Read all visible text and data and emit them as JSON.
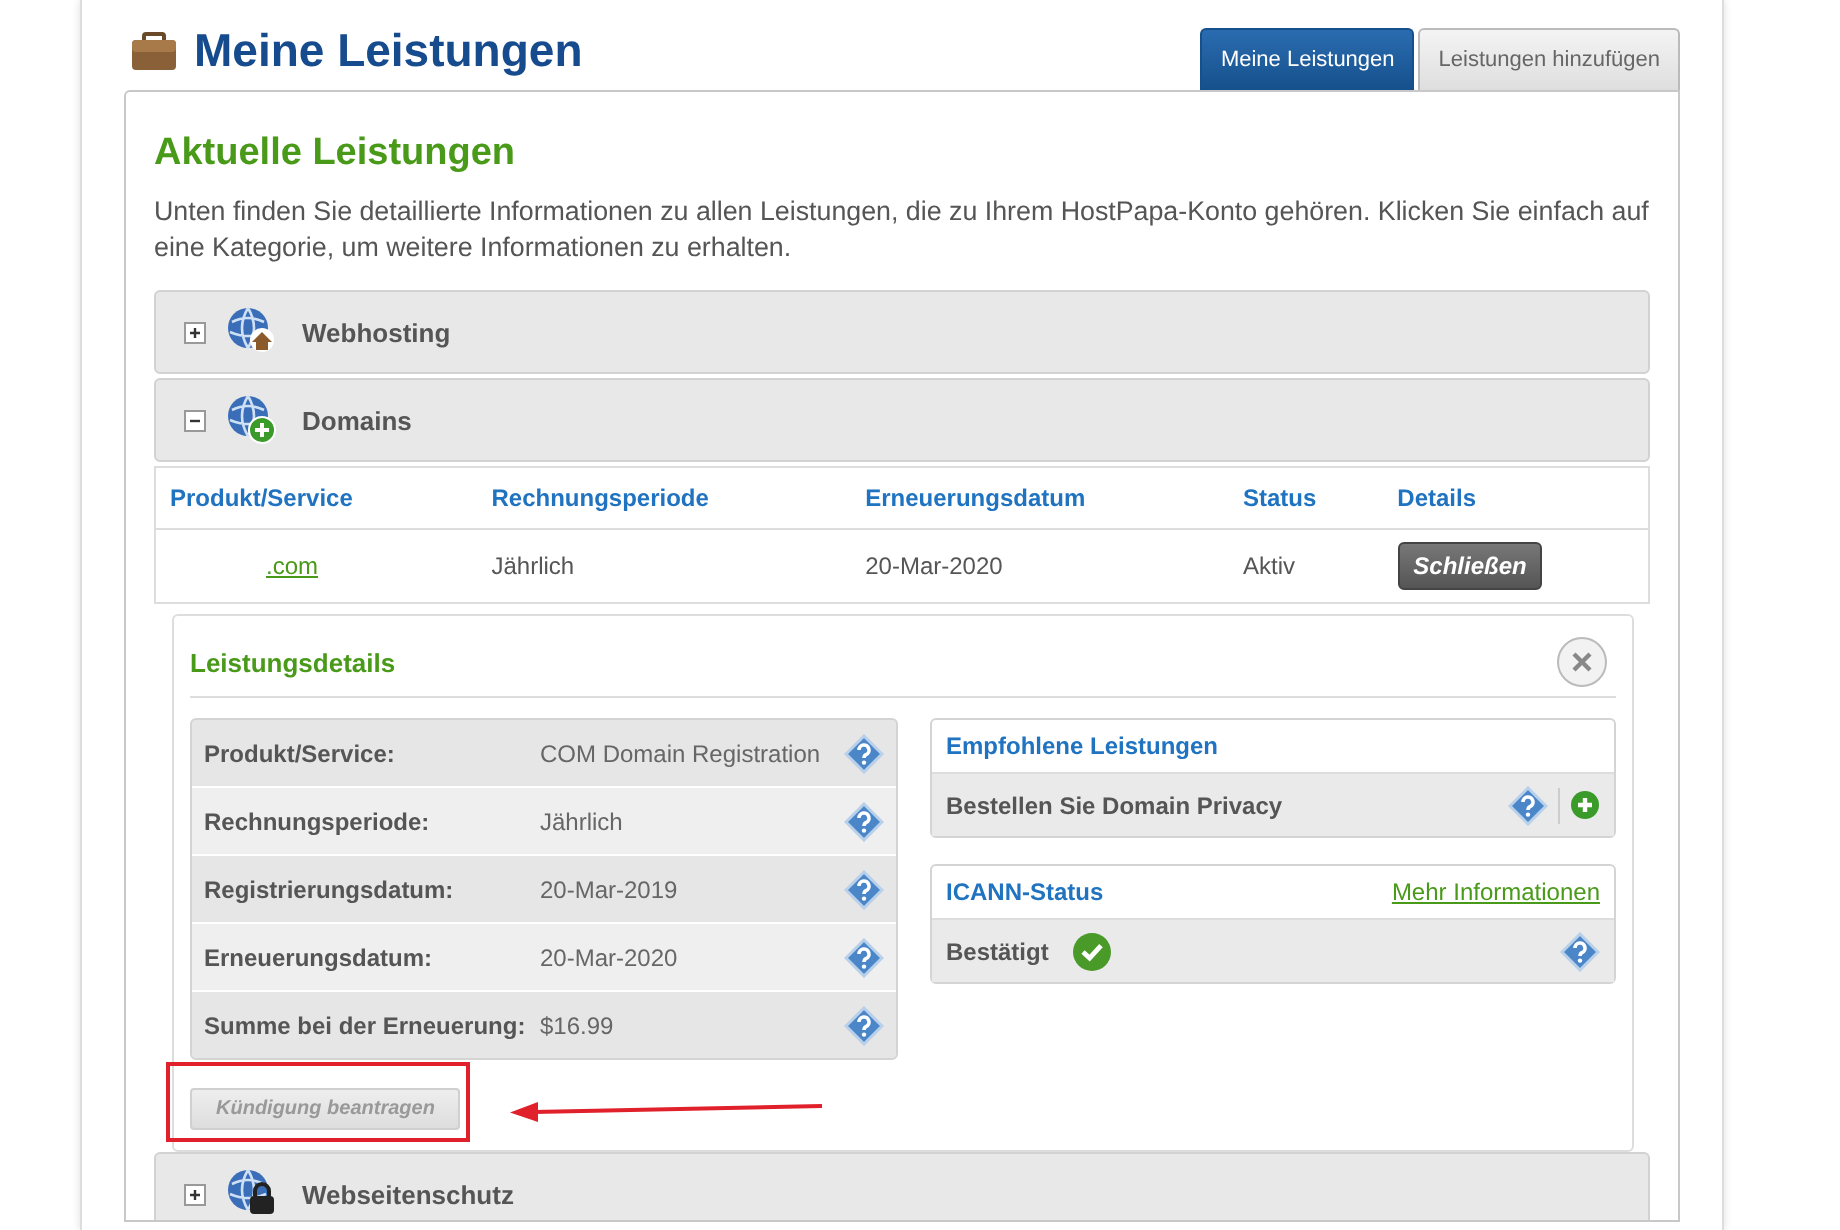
{
  "page": {
    "title": "Meine Leistungen"
  },
  "tabs": [
    {
      "label": "Meine Leistungen",
      "selected": true
    },
    {
      "label": "Leistungen hinzufügen",
      "selected": false
    }
  ],
  "section": {
    "title": "Aktuelle Leistungen",
    "intro": "Unten finden Sie detaillierte Informationen zu allen Leistungen, die zu Ihrem HostPapa-Konto gehören. Klicken Sie einfach auf eine Kategorie, um weitere Informationen zu erhalten."
  },
  "categories": [
    {
      "label": "Webhosting",
      "expanded": false
    },
    {
      "label": "Domains",
      "expanded": true
    },
    {
      "label": "Webseitenschutz",
      "expanded": false
    }
  ],
  "table": {
    "columns": [
      "Produkt/Service",
      "Rechnungsperiode",
      "Erneuerungsdatum",
      "Status",
      "Details"
    ],
    "rows": [
      {
        "product": ".com",
        "period": "Jährlich",
        "renewal": "20-Mar-2020",
        "status": "Aktiv",
        "button": "Schließen"
      }
    ]
  },
  "details": {
    "title": "Leistungsdetails",
    "fields": [
      {
        "label": "Produkt/Service:",
        "value": "COM Domain Registration"
      },
      {
        "label": "Rechnungsperiode:",
        "value": "Jährlich"
      },
      {
        "label": "Registrierungsdatum:",
        "value": "20-Mar-2019"
      },
      {
        "label": "Erneuerungsdatum:",
        "value": "20-Mar-2020"
      },
      {
        "label": "Summe bei der Erneuerung:",
        "value": "$16.99"
      }
    ],
    "recommended": {
      "title": "Empfohlene Leistungen",
      "items": [
        {
          "label": "Bestellen Sie Domain Privacy"
        }
      ]
    },
    "icann": {
      "title": "ICANN-Status",
      "link": "Mehr Informationen",
      "status": "Bestätigt",
      "verified": true
    },
    "cancel_button": {
      "label": "Kündigung beantragen",
      "disabled": true
    }
  }
}
